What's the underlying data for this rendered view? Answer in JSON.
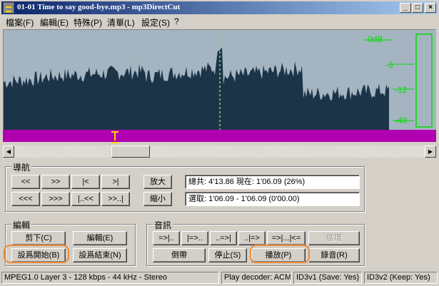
{
  "window": {
    "title": "01-01 Time to say good-bye.mp3 - mp3DirectCut",
    "min_glyph": "_",
    "max_glyph": "□",
    "close_glyph": "×"
  },
  "menu": [
    "檔案(F)",
    "編輯(E)",
    "特殊(P)",
    "清單(L)",
    "設定(S)",
    "?"
  ],
  "vu_meter": {
    "labels": [
      "0dB",
      "-6",
      "-12",
      "-48"
    ],
    "color": "#00dd00"
  },
  "colors": {
    "wave_bg": "#a4b5c1",
    "wave_fill": "#1c3448",
    "selection_bar": "#b000b0",
    "cursor": "#ffd800",
    "title_start": "#0a246a",
    "title_end": "#a6caf0",
    "highlight": "#e88a3d"
  },
  "playhead_fraction": 0.5,
  "scroll": {
    "left_glyph": "◀",
    "right_glyph": "▶"
  },
  "navigation": {
    "title": "導航",
    "buttons_row1": [
      "<<",
      ">>",
      "|<",
      ">|"
    ],
    "buttons_row2": [
      "<<<",
      ">>>",
      "|..<<",
      ">>..|"
    ],
    "zoom_in": "放大",
    "zoom_out": "縮小",
    "info_total": "總共: 4'13.86  現在: 1'06.09  (26%)",
    "info_selection": "選取: 1'06.09 - 1'06.09 (0'00.00)"
  },
  "edit": {
    "title": "編輯",
    "cut": "剪下(C)",
    "edit": "編輯(E)",
    "set_start": "設爲開始(B)",
    "set_end": "設爲結束(N)"
  },
  "audio": {
    "title": "音訊",
    "row1": [
      "=>|..",
      "|=>..",
      "..=>|",
      "..|=>",
      "=>|...|<=",
      "循環"
    ],
    "rewind": "倒帶",
    "stop": "停止(S)",
    "play": "播放(P)",
    "record": "錄音(R)"
  },
  "status": {
    "format": "MPEG1.0 Layer 3 - 128 kbps - 44 kHz - Stereo",
    "decoder": "Play decoder: ACM",
    "id3v1": "ID3v1 (Save: Yes)",
    "id3v2": "ID3v2 (Keep: Yes)"
  }
}
